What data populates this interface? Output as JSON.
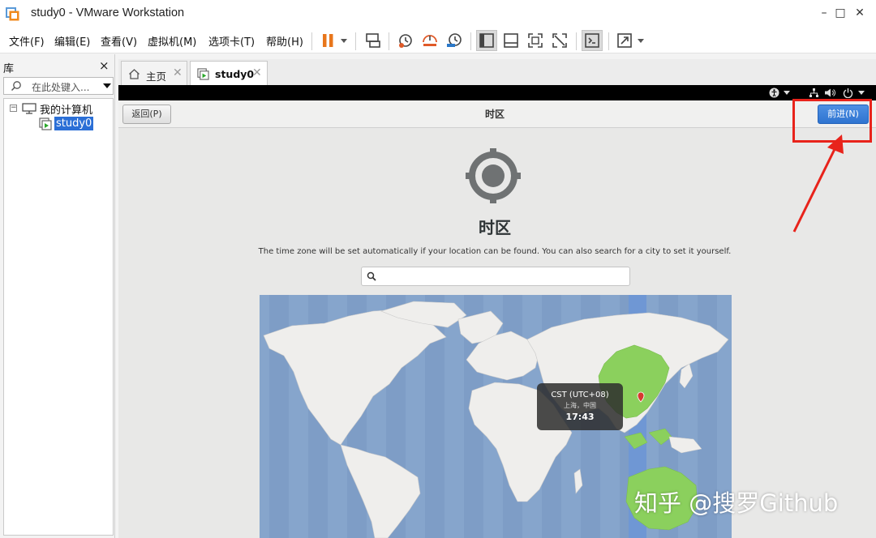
{
  "window": {
    "title": "study0 - VMware Workstation",
    "minimize": "–",
    "maximize": "□",
    "close": "✕"
  },
  "menu": {
    "items": [
      "文件(F)",
      "编辑(E)",
      "查看(V)",
      "虚拟机(M)",
      "选项卡(T)",
      "帮助(H)"
    ]
  },
  "toolbar": {
    "icons": [
      "pause-icon",
      "send-ctrl-alt-del-icon",
      "snapshot-icon",
      "revert-snapshot-icon",
      "snapshot-manager-icon",
      "library-view-icon",
      "thumbnail-view-icon",
      "fullscreen-icon",
      "unity-icon",
      "console-icon",
      "stretch-icon"
    ],
    "pause_color": "#e8761b"
  },
  "library": {
    "title": "库",
    "close": "×",
    "search_placeholder": "在此处键入...",
    "tree": {
      "expander": "−",
      "root_label": "我的计算机",
      "vm_label": "study0"
    }
  },
  "tabs": [
    {
      "label": "主页",
      "close": "✕"
    },
    {
      "label": "study0",
      "close": "✕"
    }
  ],
  "installer": {
    "back_label": "返回(P)",
    "header_title": "时区",
    "next_label": "前进(N)",
    "heading": "时区",
    "description": "The time zone will be set automatically if your location can be found. You can also search for a city to set it yourself.",
    "search_value": "",
    "accent_color": "#3a7fd9"
  },
  "map": {
    "popup": {
      "zone": "CST (UTC+08)",
      "city": "上海，中国",
      "time": "17:43"
    },
    "selected_region_color": "#8bd05d",
    "ocean_color": "#86a5cc",
    "land_color": "#efeeec"
  },
  "annotation": {
    "color": "#e8231b"
  },
  "watermark": "知乎 @搜罗Github"
}
